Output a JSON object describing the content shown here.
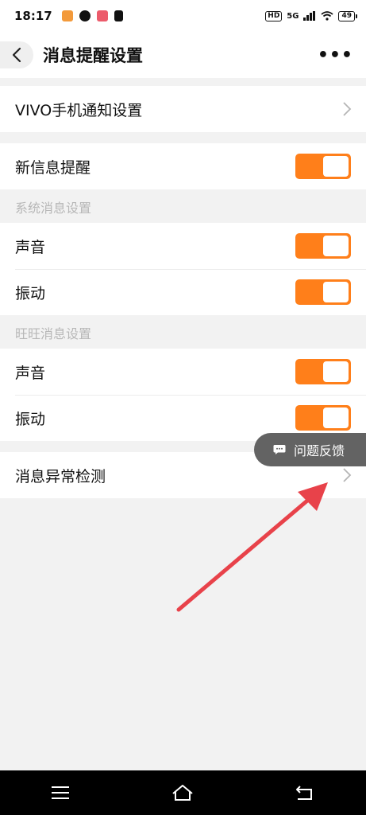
{
  "status_bar": {
    "time": "18:17",
    "network": "5G",
    "hd": "HD",
    "battery": "49"
  },
  "nav": {
    "title": "消息提醒设置",
    "more": "•••"
  },
  "vivo_row": {
    "label": "VIVO手机通知设置"
  },
  "new_msg_row": {
    "label": "新信息提醒",
    "enabled": true
  },
  "system_section": {
    "header": "系统消息设置",
    "sound_label": "声音",
    "vibrate_label": "振动"
  },
  "wangwang_section": {
    "header": "旺旺消息设置",
    "sound_label": "声音",
    "vibrate_label": "振动"
  },
  "anomaly_row": {
    "label": "消息异常检测"
  },
  "feedback": {
    "label": "问题反馈"
  },
  "colors": {
    "toggle_on": "#ff7f1a",
    "annotation_arrow": "#e8424a",
    "feedback_bg": "#636363"
  }
}
